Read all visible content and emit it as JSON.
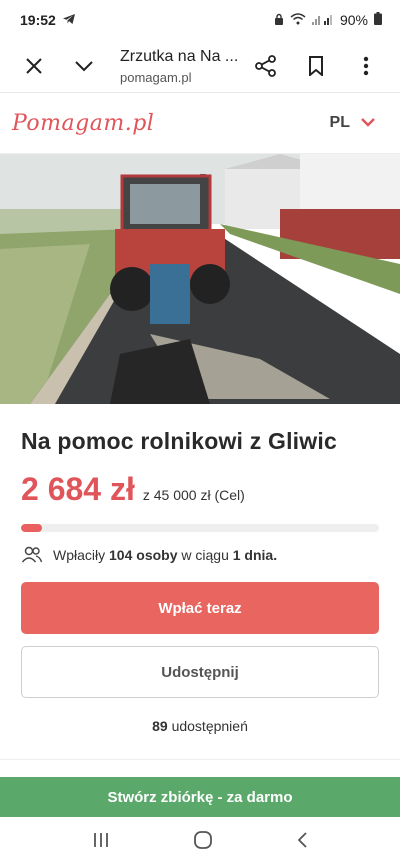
{
  "status": {
    "time": "19:52",
    "battery": "90%"
  },
  "browser": {
    "page_title": "Zrzutka na Na ...",
    "domain": "pomagam.pl"
  },
  "site": {
    "logo": "Pomagam.pl",
    "language": "PL"
  },
  "campaign": {
    "title": "Na pomoc rolnikowi z Gliwic",
    "amount": "2 684 zł",
    "goal_text": "z 45 000 zł (Cel)",
    "progress_fraction": 0.06,
    "donors_prefix": "Wpłaciły ",
    "donors_count": "104 osoby",
    "donors_mid": " w ciągu ",
    "donors_days": "1 dnia.",
    "donate_label": "Wpłać teraz",
    "share_label": "Udostępnij",
    "shares_count": "89",
    "shares_text": " udostępnień"
  },
  "cta": {
    "label": "Stwórz zbiórkę - za darmo"
  },
  "colors": {
    "accent": "#e0555a",
    "cta_green": "#5aa86a"
  }
}
